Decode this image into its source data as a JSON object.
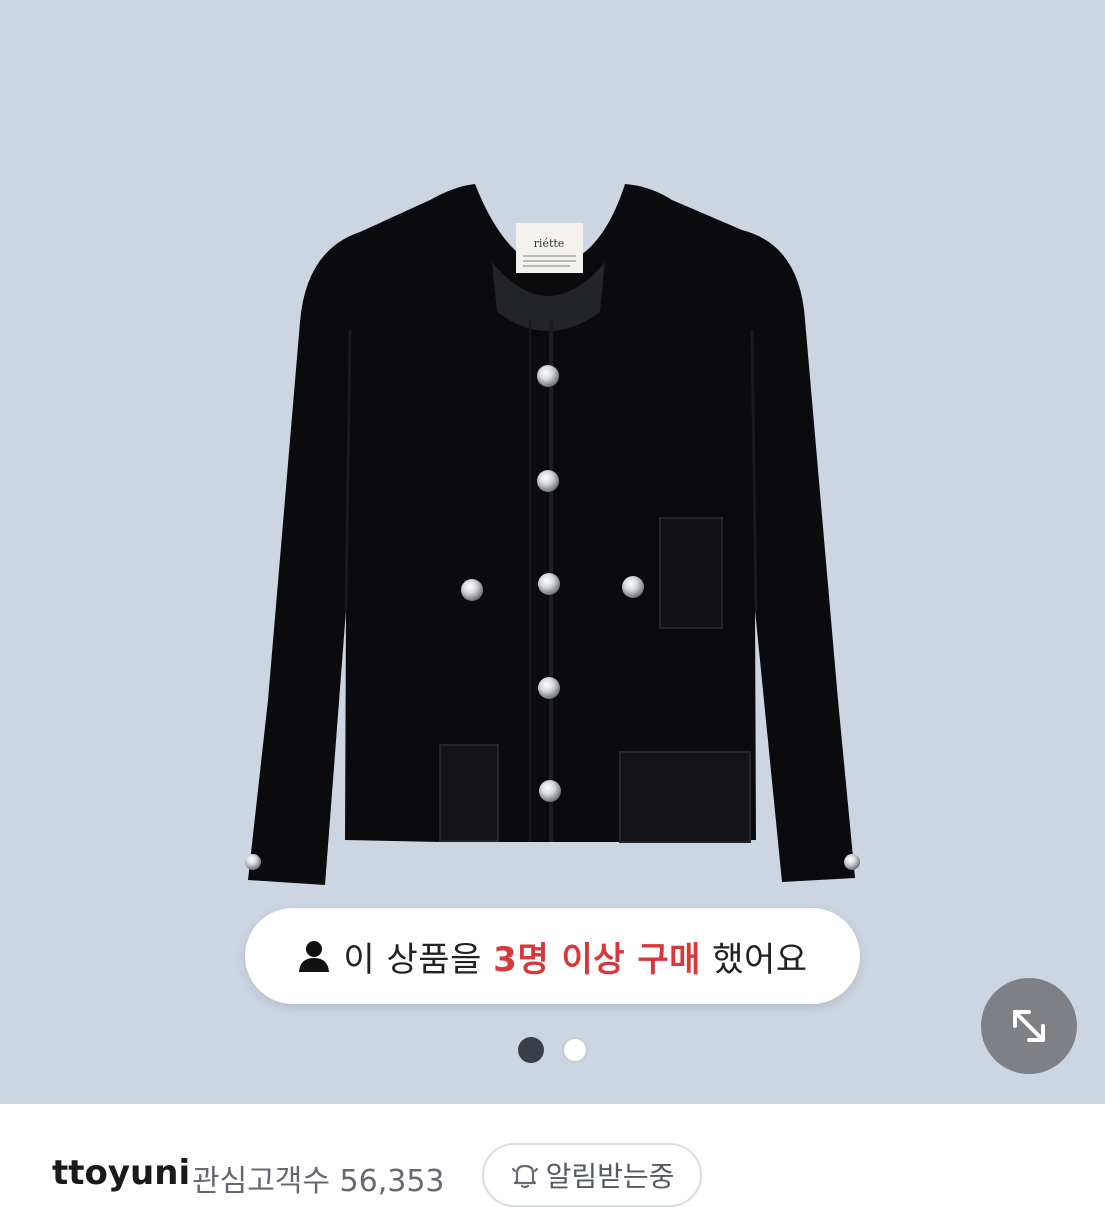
{
  "product": {
    "brand_label": "riétte",
    "background_color": "#ccd6e2"
  },
  "purchase_notice": {
    "prefix": "이 상품을 ",
    "highlight": "3명 이상 구매",
    "suffix": " 했어요",
    "highlight_color": "#d8383a"
  },
  "gallery": {
    "dots": [
      {
        "state": "active"
      },
      {
        "state": "inactive"
      }
    ],
    "expand_icon": "expand-arrows-icon"
  },
  "seller": {
    "name": "ttoyuni",
    "followers_label": "관심고객수",
    "followers_count": "56,353",
    "alarm_label": "알림받는중",
    "alarm_icon": "bell-icon"
  }
}
